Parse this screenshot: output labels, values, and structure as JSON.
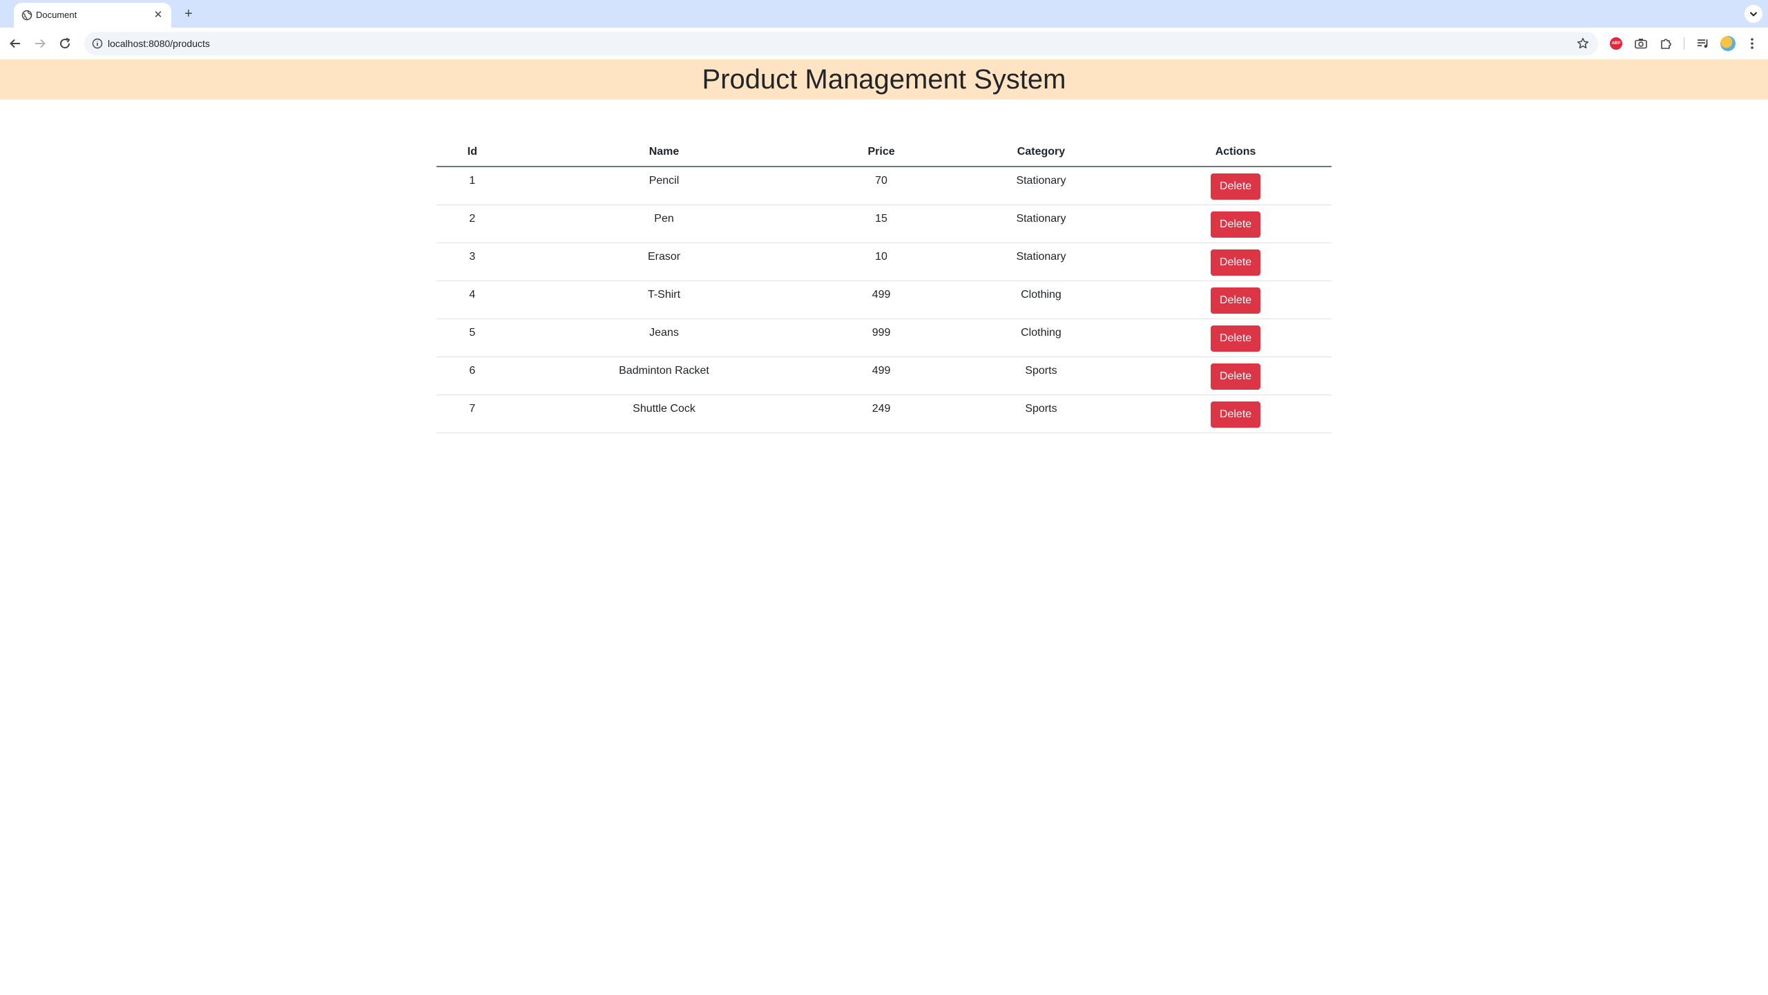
{
  "browser": {
    "tab_title": "Document",
    "new_tab_label": "+",
    "close_label": "✕",
    "url": "localhost:8080/products"
  },
  "page": {
    "title": "Product Management System"
  },
  "table": {
    "headers": [
      "Id",
      "Name",
      "Price",
      "Category",
      "Actions"
    ],
    "delete_label": "Delete",
    "rows": [
      {
        "id": "1",
        "name": "Pencil",
        "price": "70",
        "category": "Stationary"
      },
      {
        "id": "2",
        "name": "Pen",
        "price": "15",
        "category": "Stationary"
      },
      {
        "id": "3",
        "name": "Erasor",
        "price": "10",
        "category": "Stationary"
      },
      {
        "id": "4",
        "name": "T-Shirt",
        "price": "499",
        "category": "Clothing"
      },
      {
        "id": "5",
        "name": "Jeans",
        "price": "999",
        "category": "Clothing"
      },
      {
        "id": "6",
        "name": "Badminton Racket",
        "price": "499",
        "category": "Sports"
      },
      {
        "id": "7",
        "name": "Shuttle Cock",
        "price": "249",
        "category": "Sports"
      }
    ]
  },
  "colors": {
    "header_bg": "#ffe4c4",
    "delete_button": "#dc3545",
    "tabstrip_bg": "#d3e3fd"
  }
}
